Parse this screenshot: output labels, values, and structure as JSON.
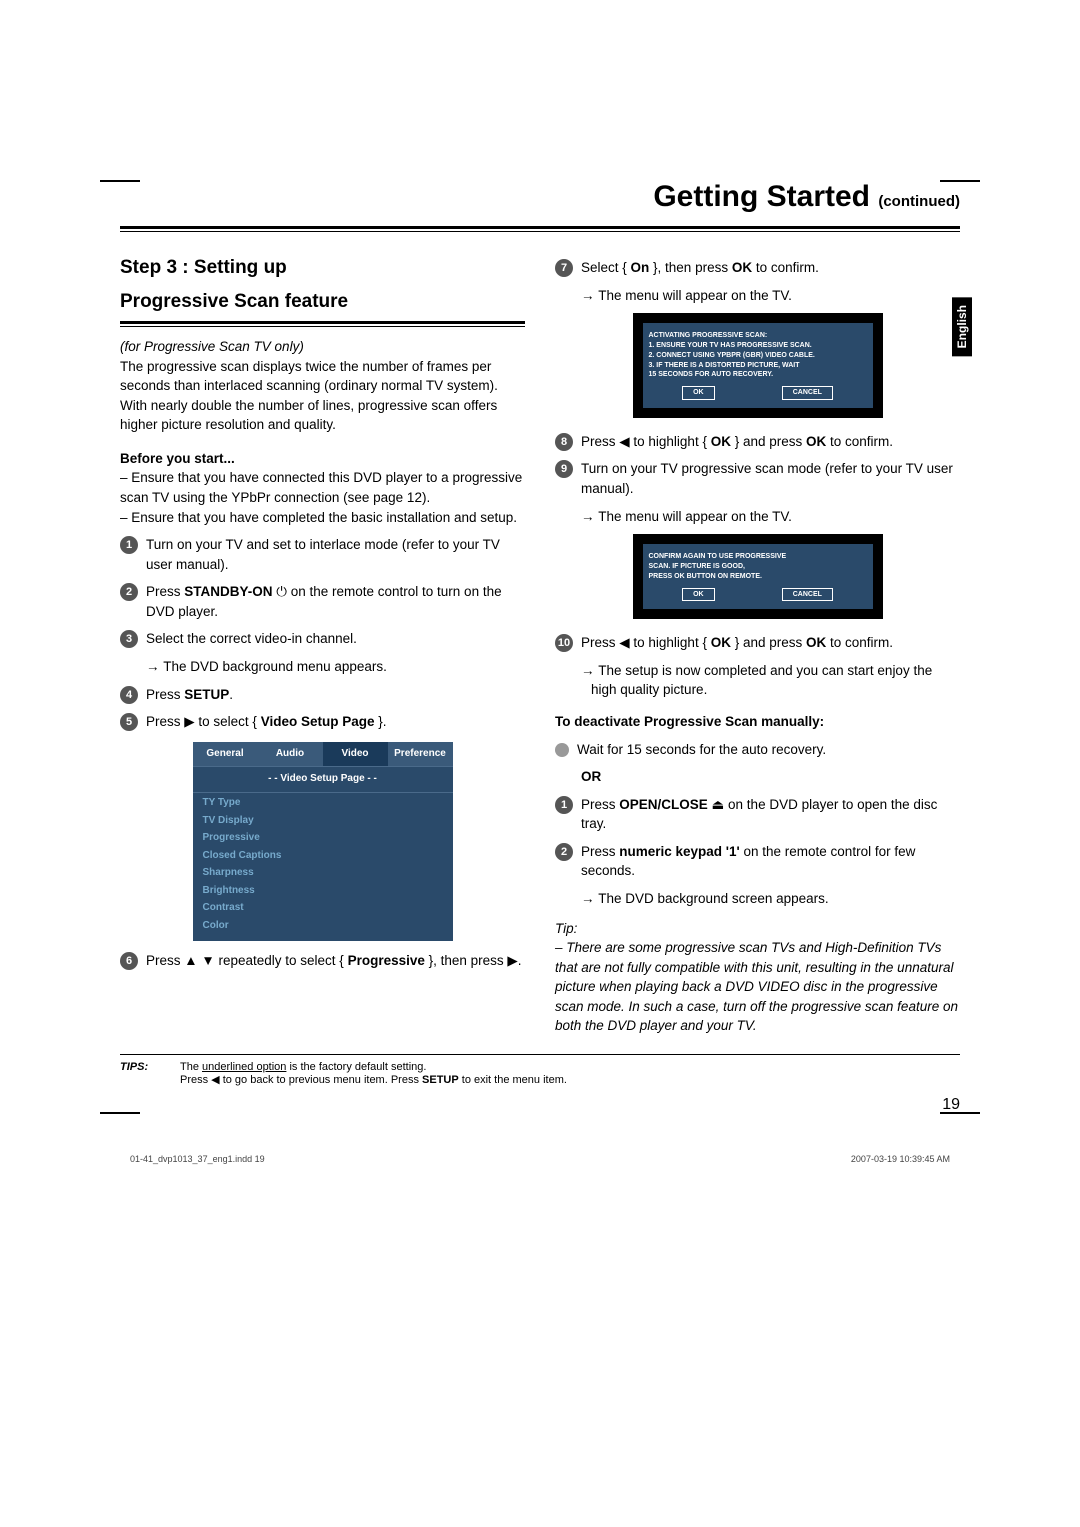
{
  "header": {
    "title": "Getting Started",
    "continued": "(continued)"
  },
  "lang_tab": "English",
  "left": {
    "section_heading_1": "Step 3 : Setting up",
    "section_heading_2": "Progressive Scan feature",
    "intro_italic": "(for Progressive Scan TV only)",
    "intro_body": "The progressive scan displays twice the number of frames per seconds than interlaced scanning (ordinary normal TV system). With nearly double the number of lines, progressive scan offers higher picture resolution and quality.",
    "before_heading": "Before you start...",
    "before_1": "– Ensure that you have connected this DVD player to a progressive scan TV using the YPbPr connection (see page 12).",
    "before_2": "– Ensure that you have completed the basic installation and setup.",
    "step1": "Turn on your TV and set to interlace mode (refer to your TV user manual).",
    "step2_a": "Press ",
    "step2_b": "STANDBY-ON",
    "step2_c": " ⏻ on the remote control to turn on the DVD player.",
    "step3": "Select the correct video-in channel.",
    "step3_arrow": "The DVD background menu appears.",
    "step4_a": "Press ",
    "step4_b": "SETUP",
    "step4_c": ".",
    "step5_a": "Press ▶ to select { ",
    "step5_b": "Video Setup Page",
    "step5_c": " }.",
    "menu": {
      "tabs": [
        "General",
        "Audio",
        "Video",
        "Preference"
      ],
      "subtitle": "- -  Video Setup Page  - -",
      "items": [
        "TY Type",
        "TV Display",
        "Progressive",
        "Closed Captions",
        "Sharpness",
        "Brightness",
        "Contrast",
        "Color"
      ]
    },
    "step6_a": "Press ▲ ▼ repeatedly to select { ",
    "step6_b": "Progressive",
    "step6_c": " }, then press ▶."
  },
  "right": {
    "step7_a": "Select { ",
    "step7_b": "On",
    "step7_c": " }, then press ",
    "step7_d": "OK",
    "step7_e": " to confirm.",
    "step7_arrow": "The menu will appear on the TV.",
    "dialog1": {
      "l1": "ACTIVATING PROGRESSIVE SCAN:",
      "l2": "1. ENSURE YOUR TV HAS PROGRESSIVE SCAN.",
      "l3": "2. CONNECT USING YPBPR (GBR) VIDEO CABLE.",
      "l4": "3. IF THERE IS A DISTORTED PICTURE, WAIT",
      "l5": "   15 SECONDS FOR AUTO RECOVERY.",
      "ok": "OK",
      "cancel": "CANCEL"
    },
    "step8_a": "Press ◀ to highlight { ",
    "step8_b": "OK",
    "step8_c": " } and press ",
    "step8_d": "OK",
    "step8_e": " to confirm.",
    "step9_a": "Turn on your TV progressive scan mode (refer to your TV user manual).",
    "step9_arrow": "The menu will appear on the TV.",
    "dialog2": {
      "l1": "CONFIRM AGAIN TO USE PROGRESSIVE",
      "l2": "SCAN. IF PICTURE IS GOOD,",
      "l3": "PRESS OK BUTTON ON REMOTE.",
      "ok": "OK",
      "cancel": "CANCEL"
    },
    "step10_a": "Press ◀ to highlight { ",
    "step10_b": "OK",
    "step10_c": " } and press ",
    "step10_d": "OK",
    "step10_e": " to confirm.",
    "step10_arrow": "The setup is now completed and you can start enjoy the high quality picture.",
    "deact_heading": "To deactivate Progressive Scan manually:",
    "deact_bullet": "Wait for 15 seconds for the auto recovery.",
    "or": "OR",
    "d1_a": "Press ",
    "d1_b": "OPEN/CLOSE",
    "d1_c": " ⏏ on the DVD player to open the disc tray.",
    "d2_a": "Press ",
    "d2_b": "numeric keypad '1'",
    "d2_c": " on the remote control for few seconds.",
    "d2_arrow": "The DVD background screen appears.",
    "tip_label": "Tip:",
    "tip_body": "– There are some progressive scan TVs and High-Definition TVs that are not fully compatible with this unit, resulting in the unnatural picture when playing back a DVD VIDEO disc in the progressive scan mode. In such a case, turn off the progressive scan feature on both the DVD player and your TV."
  },
  "tips": {
    "label": "TIPS:",
    "line1a": "The ",
    "line1b": "underlined option",
    "line1c": " is the factory default setting.",
    "line2a": "Press ◀ to go back to previous menu item. Press ",
    "line2b": "SETUP",
    "line2c": " to exit the menu item."
  },
  "page_number": "19",
  "print_footer": {
    "left": "01-41_dvp1013_37_eng1.indd   19",
    "right": "2007-03-19   10:39:45 AM"
  }
}
